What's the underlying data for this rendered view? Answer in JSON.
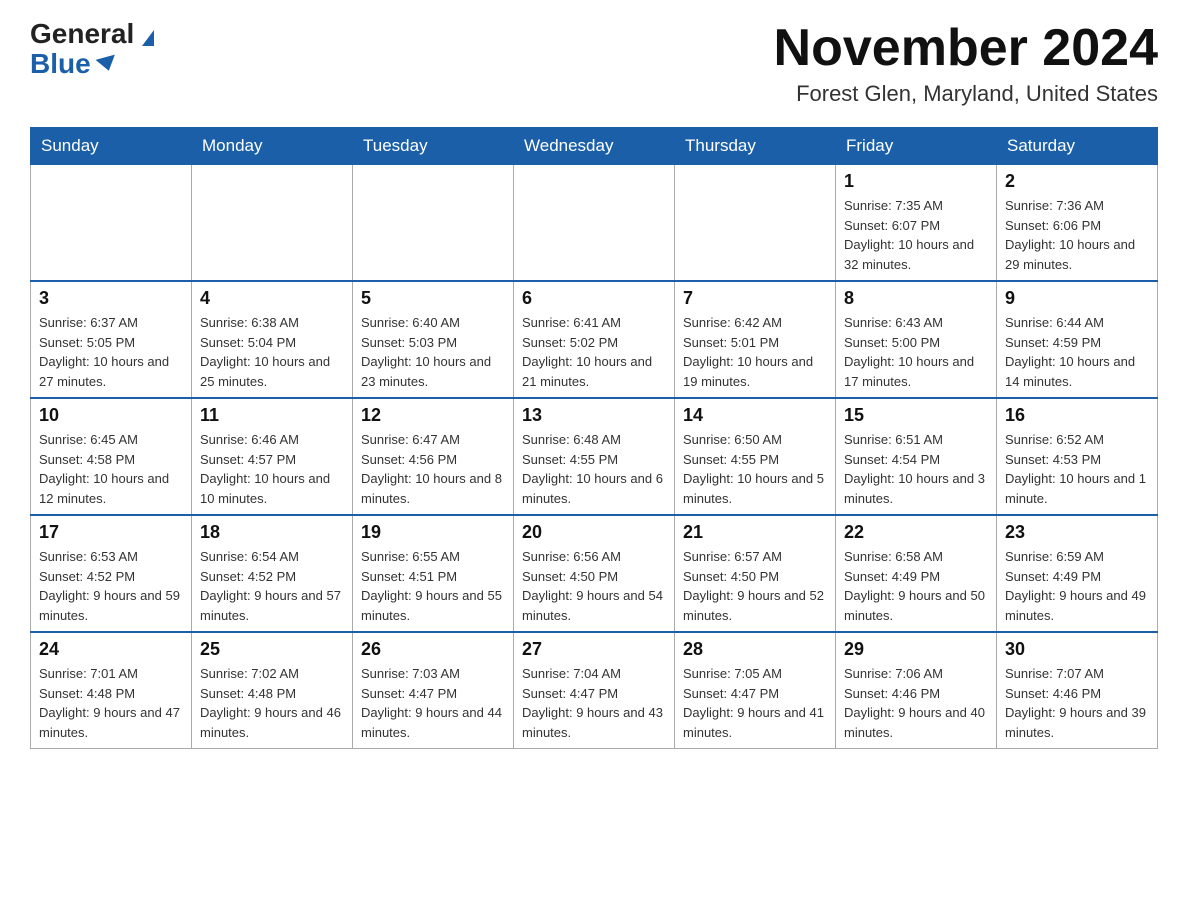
{
  "header": {
    "logo_general": "General",
    "logo_blue": "Blue",
    "month_title": "November 2024",
    "location": "Forest Glen, Maryland, United States"
  },
  "days_of_week": [
    "Sunday",
    "Monday",
    "Tuesday",
    "Wednesday",
    "Thursday",
    "Friday",
    "Saturday"
  ],
  "weeks": [
    [
      {
        "day": "",
        "info": ""
      },
      {
        "day": "",
        "info": ""
      },
      {
        "day": "",
        "info": ""
      },
      {
        "day": "",
        "info": ""
      },
      {
        "day": "",
        "info": ""
      },
      {
        "day": "1",
        "info": "Sunrise: 7:35 AM\nSunset: 6:07 PM\nDaylight: 10 hours and 32 minutes."
      },
      {
        "day": "2",
        "info": "Sunrise: 7:36 AM\nSunset: 6:06 PM\nDaylight: 10 hours and 29 minutes."
      }
    ],
    [
      {
        "day": "3",
        "info": "Sunrise: 6:37 AM\nSunset: 5:05 PM\nDaylight: 10 hours and 27 minutes."
      },
      {
        "day": "4",
        "info": "Sunrise: 6:38 AM\nSunset: 5:04 PM\nDaylight: 10 hours and 25 minutes."
      },
      {
        "day": "5",
        "info": "Sunrise: 6:40 AM\nSunset: 5:03 PM\nDaylight: 10 hours and 23 minutes."
      },
      {
        "day": "6",
        "info": "Sunrise: 6:41 AM\nSunset: 5:02 PM\nDaylight: 10 hours and 21 minutes."
      },
      {
        "day": "7",
        "info": "Sunrise: 6:42 AM\nSunset: 5:01 PM\nDaylight: 10 hours and 19 minutes."
      },
      {
        "day": "8",
        "info": "Sunrise: 6:43 AM\nSunset: 5:00 PM\nDaylight: 10 hours and 17 minutes."
      },
      {
        "day": "9",
        "info": "Sunrise: 6:44 AM\nSunset: 4:59 PM\nDaylight: 10 hours and 14 minutes."
      }
    ],
    [
      {
        "day": "10",
        "info": "Sunrise: 6:45 AM\nSunset: 4:58 PM\nDaylight: 10 hours and 12 minutes."
      },
      {
        "day": "11",
        "info": "Sunrise: 6:46 AM\nSunset: 4:57 PM\nDaylight: 10 hours and 10 minutes."
      },
      {
        "day": "12",
        "info": "Sunrise: 6:47 AM\nSunset: 4:56 PM\nDaylight: 10 hours and 8 minutes."
      },
      {
        "day": "13",
        "info": "Sunrise: 6:48 AM\nSunset: 4:55 PM\nDaylight: 10 hours and 6 minutes."
      },
      {
        "day": "14",
        "info": "Sunrise: 6:50 AM\nSunset: 4:55 PM\nDaylight: 10 hours and 5 minutes."
      },
      {
        "day": "15",
        "info": "Sunrise: 6:51 AM\nSunset: 4:54 PM\nDaylight: 10 hours and 3 minutes."
      },
      {
        "day": "16",
        "info": "Sunrise: 6:52 AM\nSunset: 4:53 PM\nDaylight: 10 hours and 1 minute."
      }
    ],
    [
      {
        "day": "17",
        "info": "Sunrise: 6:53 AM\nSunset: 4:52 PM\nDaylight: 9 hours and 59 minutes."
      },
      {
        "day": "18",
        "info": "Sunrise: 6:54 AM\nSunset: 4:52 PM\nDaylight: 9 hours and 57 minutes."
      },
      {
        "day": "19",
        "info": "Sunrise: 6:55 AM\nSunset: 4:51 PM\nDaylight: 9 hours and 55 minutes."
      },
      {
        "day": "20",
        "info": "Sunrise: 6:56 AM\nSunset: 4:50 PM\nDaylight: 9 hours and 54 minutes."
      },
      {
        "day": "21",
        "info": "Sunrise: 6:57 AM\nSunset: 4:50 PM\nDaylight: 9 hours and 52 minutes."
      },
      {
        "day": "22",
        "info": "Sunrise: 6:58 AM\nSunset: 4:49 PM\nDaylight: 9 hours and 50 minutes."
      },
      {
        "day": "23",
        "info": "Sunrise: 6:59 AM\nSunset: 4:49 PM\nDaylight: 9 hours and 49 minutes."
      }
    ],
    [
      {
        "day": "24",
        "info": "Sunrise: 7:01 AM\nSunset: 4:48 PM\nDaylight: 9 hours and 47 minutes."
      },
      {
        "day": "25",
        "info": "Sunrise: 7:02 AM\nSunset: 4:48 PM\nDaylight: 9 hours and 46 minutes."
      },
      {
        "day": "26",
        "info": "Sunrise: 7:03 AM\nSunset: 4:47 PM\nDaylight: 9 hours and 44 minutes."
      },
      {
        "day": "27",
        "info": "Sunrise: 7:04 AM\nSunset: 4:47 PM\nDaylight: 9 hours and 43 minutes."
      },
      {
        "day": "28",
        "info": "Sunrise: 7:05 AM\nSunset: 4:47 PM\nDaylight: 9 hours and 41 minutes."
      },
      {
        "day": "29",
        "info": "Sunrise: 7:06 AM\nSunset: 4:46 PM\nDaylight: 9 hours and 40 minutes."
      },
      {
        "day": "30",
        "info": "Sunrise: 7:07 AM\nSunset: 4:46 PM\nDaylight: 9 hours and 39 minutes."
      }
    ]
  ]
}
